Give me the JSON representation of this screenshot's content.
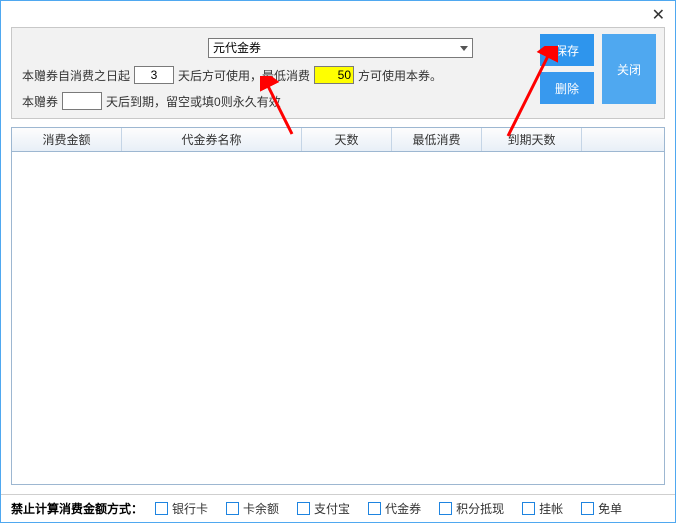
{
  "window": {
    "close_x": "✕"
  },
  "form": {
    "voucher_select_value": "元代金券",
    "line1_prefix": "本赠券自消费之日起",
    "days_after_consume": "3",
    "line1_mid": "天后方可使用，最低消费",
    "min_consume": "50",
    "line1_suffix": "方可使用本券。",
    "line2_prefix": "本赠券",
    "expire_days": "",
    "line2_suffix": "天后到期，留空或填0则永久有效"
  },
  "buttons": {
    "save": "保存",
    "delete": "删除",
    "close": "关闭"
  },
  "grid": {
    "cols": {
      "amount": "消费金额",
      "name": "代金券名称",
      "days": "天数",
      "min": "最低消费",
      "expire": "到期天数"
    }
  },
  "footer": {
    "label": "禁止计算消费金额方式：",
    "opts": {
      "bank": "银行卡",
      "balance": "卡余额",
      "alipay": "支付宝",
      "voucher": "代金券",
      "points": "积分抵现",
      "credit": "挂帐",
      "free": "免单"
    }
  }
}
